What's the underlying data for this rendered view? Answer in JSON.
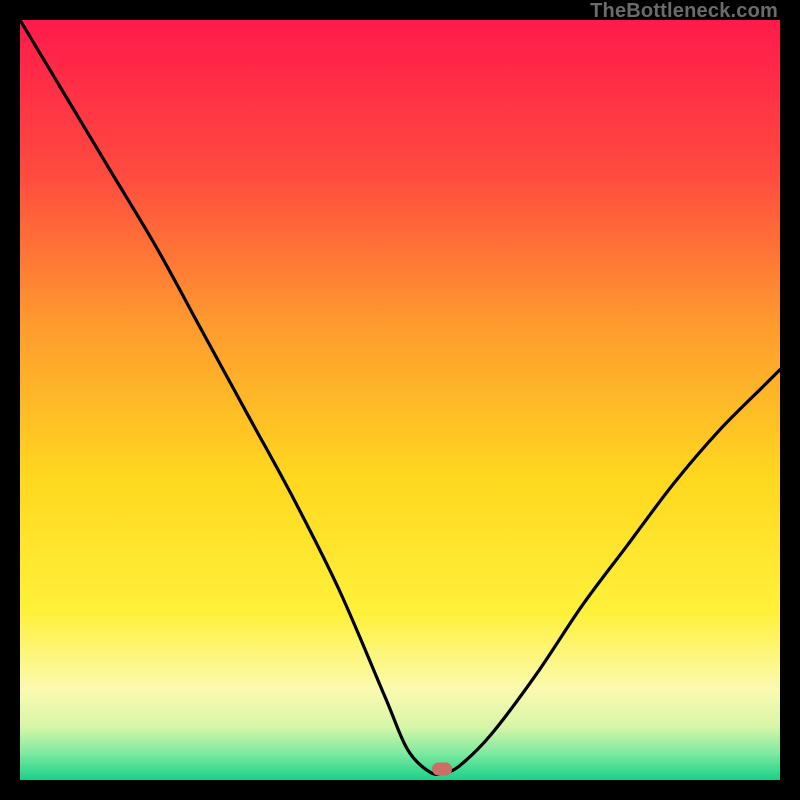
{
  "watermark": "TheBottleneck.com",
  "colors": {
    "frame": "#000000",
    "gradient_stops": [
      {
        "offset": 0.0,
        "color": "#ff1a4b"
      },
      {
        "offset": 0.2,
        "color": "#ff4a3f"
      },
      {
        "offset": 0.4,
        "color": "#ff9a2f"
      },
      {
        "offset": 0.6,
        "color": "#ffd71f"
      },
      {
        "offset": 0.78,
        "color": "#fff13a"
      },
      {
        "offset": 0.88,
        "color": "#fbfab0"
      },
      {
        "offset": 0.93,
        "color": "#d7f6a8"
      },
      {
        "offset": 0.965,
        "color": "#7ee9a0"
      },
      {
        "offset": 1.0,
        "color": "#18d18a"
      }
    ],
    "curve": "#000000",
    "marker": "#cc6e66"
  },
  "marker": {
    "x_frac": 0.555,
    "y_frac": 0.985
  },
  "chart_data": {
    "type": "line",
    "title": "",
    "xlabel": "",
    "ylabel": "",
    "xlim": [
      0,
      100
    ],
    "ylim": [
      0,
      100
    ],
    "series": [
      {
        "name": "bottleneck-curve",
        "x": [
          0,
          6,
          12,
          18,
          24,
          30,
          36,
          42,
          48,
          51,
          54,
          56,
          58,
          62,
          68,
          74,
          80,
          86,
          92,
          98,
          100
        ],
        "y": [
          100,
          90,
          80,
          70,
          59,
          48,
          37,
          25,
          11,
          4,
          1,
          1,
          2,
          6,
          14,
          23,
          31,
          39,
          46,
          52,
          54
        ]
      }
    ],
    "annotations": [
      {
        "type": "marker",
        "x": 55.5,
        "y": 1.5,
        "label": "optimal-point"
      }
    ],
    "background": "vertical-gradient red→orange→yellow→green (heat scale)"
  }
}
